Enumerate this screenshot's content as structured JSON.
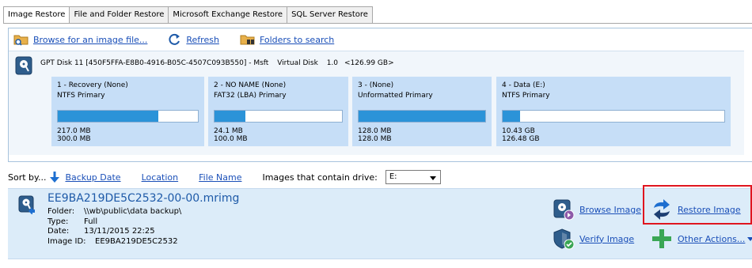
{
  "tabs": [
    {
      "label": "Image Restore",
      "active": true
    },
    {
      "label": "File and Folder Restore",
      "active": false
    },
    {
      "label": "Microsoft Exchange Restore",
      "active": false
    },
    {
      "label": "SQL Server Restore",
      "active": false
    }
  ],
  "toolbar": {
    "browse_label": "Browse for an image file...",
    "refresh_label": "Refresh",
    "folders_label": "Folders to search"
  },
  "disk": {
    "name": "GPT Disk 11 [450F5FFA-E8B0-4916-B05C-4507C093B550] - Msft",
    "type": "Virtual Disk",
    "version": "1.0",
    "size": "<126.99 GB>"
  },
  "partitions": [
    {
      "title": "1 - Recovery (None)",
      "type": "NTFS Primary",
      "used": "217.0 MB",
      "total": "300.0 MB",
      "fill_pct": 72
    },
    {
      "title": "2 - NO NAME (None)",
      "type": "FAT32 (LBA) Primary",
      "used": "24.1 MB",
      "total": "100.0 MB",
      "fill_pct": 24
    },
    {
      "title": "3 - (None)",
      "type": "Unformatted Primary",
      "used": "128.0 MB",
      "total": "128.0 MB",
      "fill_pct": 100
    },
    {
      "title": "4 - Data (E:)",
      "type": "NTFS Primary",
      "used": "10.43 GB",
      "total": "126.48 GB",
      "fill_pct": 8
    }
  ],
  "sort": {
    "label": "Sort by...",
    "backup_date": "Backup Date",
    "location": "Location",
    "file_name": "File Name",
    "drive_label": "Images that contain drive:",
    "drive_value": "E:"
  },
  "image": {
    "filename": "EE9BA219DE5C2532-00-00.mrimg",
    "folder_label": "Folder:",
    "folder": "\\\\wb\\public\\data backup\\",
    "type_label": "Type:",
    "type": "Full",
    "date_label": "Date:",
    "date": "13/11/2015 22:25",
    "id_label": "Image ID:",
    "id": "EE9BA219DE5C2532"
  },
  "actions": {
    "browse": "Browse Image",
    "restore": "Restore Image",
    "verify": "Verify Image",
    "other": "Other Actions..."
  },
  "colors": {
    "accent": "#2b93d8",
    "link": "#1a4fb8",
    "highlight": "#e0151f",
    "partition_bg": "#c6def7",
    "result_bg": "#dcecf9"
  }
}
